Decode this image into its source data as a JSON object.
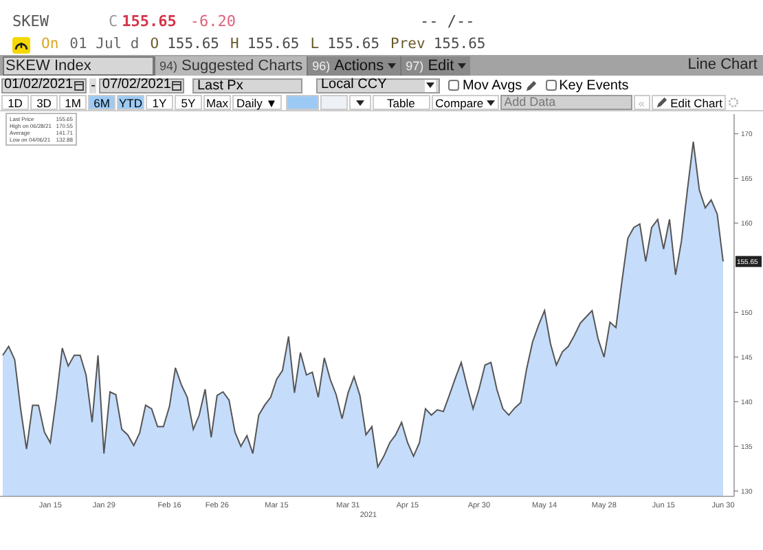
{
  "quote": {
    "ticker": "SKEW",
    "close_prefix": "C",
    "last": "155.65",
    "change": "-6.20",
    "bid_ask": "-- /--"
  },
  "session": {
    "on_label": "On",
    "date": "01 Jul d",
    "fields": [
      {
        "label": "O",
        "value": "155.65"
      },
      {
        "label": "H",
        "value": "155.65"
      },
      {
        "label": "L",
        "value": "155.65"
      },
      {
        "label": "Prev",
        "value": "155.65"
      }
    ]
  },
  "toolbar": {
    "security": "SKEW Index",
    "menus": [
      {
        "number": "94)",
        "label": "Suggested Charts",
        "dropdown": false
      },
      {
        "number": "96)",
        "label": "Actions",
        "dropdown": true
      },
      {
        "number": "97)",
        "label": "Edit",
        "dropdown": true
      }
    ],
    "chart_type": "Line Chart"
  },
  "range_row": {
    "start_date": "01/02/2021",
    "separator": "-",
    "end_date": "07/02/2021",
    "field": "Last Px",
    "currency": "Local CCY",
    "checks": [
      {
        "label": "Mov Avgs",
        "checked": false,
        "pencil": true
      },
      {
        "label": "Key Events",
        "checked": false,
        "pencil": false
      }
    ]
  },
  "period_buttons": [
    {
      "label": "1D",
      "selected": false
    },
    {
      "label": "3D",
      "selected": false
    },
    {
      "label": "1M",
      "selected": false
    },
    {
      "label": "6M",
      "selected": true
    },
    {
      "label": "YTD",
      "selected": true
    },
    {
      "label": "1Y",
      "selected": false
    },
    {
      "label": "5Y",
      "selected": false
    },
    {
      "label": "Max",
      "selected": false
    }
  ],
  "periodicity": "Daily ▼",
  "table_button": "Table",
  "compare_button": "Compare",
  "add_data": {
    "placeholder": "Add Data"
  },
  "collapse_button": "«",
  "edit_chart_button": "Edit Chart",
  "chart": {
    "legend_last_value": "155.65",
    "legend": [
      {
        "label": "High on 06/28/21",
        "value": "170.55"
      },
      {
        "label": "Average",
        "value": "141.71"
      },
      {
        "label": "Low on 04/06/21",
        "value": "132.88"
      }
    ],
    "last_tag": "155.65",
    "chart_data": {
      "type": "area",
      "xlabel": "2021",
      "ylim": [
        129.4,
        172.2
      ],
      "yticks": [
        130,
        135,
        140,
        145,
        150,
        160,
        165,
        170
      ],
      "categories": [
        null,
        null,
        null,
        null,
        null,
        null,
        null,
        null,
        "Jan 15",
        null,
        null,
        null,
        null,
        null,
        null,
        null,
        null,
        "Jan 29",
        null,
        null,
        null,
        null,
        null,
        null,
        null,
        null,
        null,
        null,
        "Feb 16",
        null,
        null,
        null,
        null,
        null,
        null,
        null,
        "Feb 26",
        null,
        null,
        null,
        null,
        null,
        null,
        null,
        null,
        null,
        "Mar 15",
        null,
        null,
        null,
        null,
        null,
        null,
        null,
        null,
        null,
        null,
        null,
        "Mar 31",
        null,
        null,
        null,
        null,
        null,
        null,
        null,
        null,
        null,
        "Apr 15",
        null,
        null,
        null,
        null,
        null,
        null,
        null,
        null,
        null,
        null,
        null,
        "Apr 30",
        null,
        null,
        null,
        null,
        null,
        null,
        null,
        null,
        null,
        null,
        "May 14",
        null,
        null,
        null,
        null,
        null,
        null,
        null,
        null,
        null,
        "May 28",
        null,
        null,
        null,
        null,
        null,
        null,
        null,
        null,
        null,
        "Jun 15",
        null,
        null,
        null,
        null,
        null,
        null,
        null,
        null,
        null,
        "Jun 30"
      ],
      "series": [
        {
          "name": "Last Price",
          "color": "#c5dcfa",
          "values": [
            145.2,
            146.2,
            144.7,
            139.2,
            134.7,
            139.6,
            139.6,
            136.6,
            135.4,
            140.4,
            146,
            144,
            145.2,
            145.2,
            143,
            137.7,
            145.2,
            134.2,
            141.1,
            140.8,
            136.9,
            136.3,
            135.1,
            136.5,
            139.6,
            139.2,
            137.2,
            137.2,
            139.5,
            143.8,
            141.9,
            140.5,
            136.9,
            138.5,
            141.4,
            136,
            140.7,
            141.1,
            140.2,
            136.6,
            135,
            136.2,
            134.2,
            138.5,
            139.6,
            140.5,
            142.5,
            143.5,
            147.3,
            141,
            145.5,
            143,
            143.3,
            140.5,
            144.9,
            142.5,
            140.8,
            138.1,
            141,
            142.8,
            140.7,
            136.3,
            137.2,
            132.7,
            133.9,
            135.4,
            136.3,
            137.7,
            135.4,
            133.9,
            135.4,
            139.2,
            138.5,
            139.1,
            138.9,
            140.7,
            142.6,
            144.4,
            141.7,
            139.2,
            141.4,
            144.1,
            144.4,
            141.4,
            139.2,
            138.5,
            139.3,
            139.9,
            143.7,
            146.7,
            148.6,
            150.2,
            146.5,
            144.1,
            145.6,
            146.2,
            147.4,
            148.8,
            149.5,
            150.2,
            147,
            145,
            148.9,
            148.3,
            153.5,
            158.3,
            159.5,
            159.9,
            155.7,
            159.5,
            160.4,
            157.1,
            160.4,
            154.2,
            158,
            163.7,
            169.1,
            163.7,
            161.7,
            162.6,
            161,
            155.7
          ]
        }
      ]
    }
  }
}
